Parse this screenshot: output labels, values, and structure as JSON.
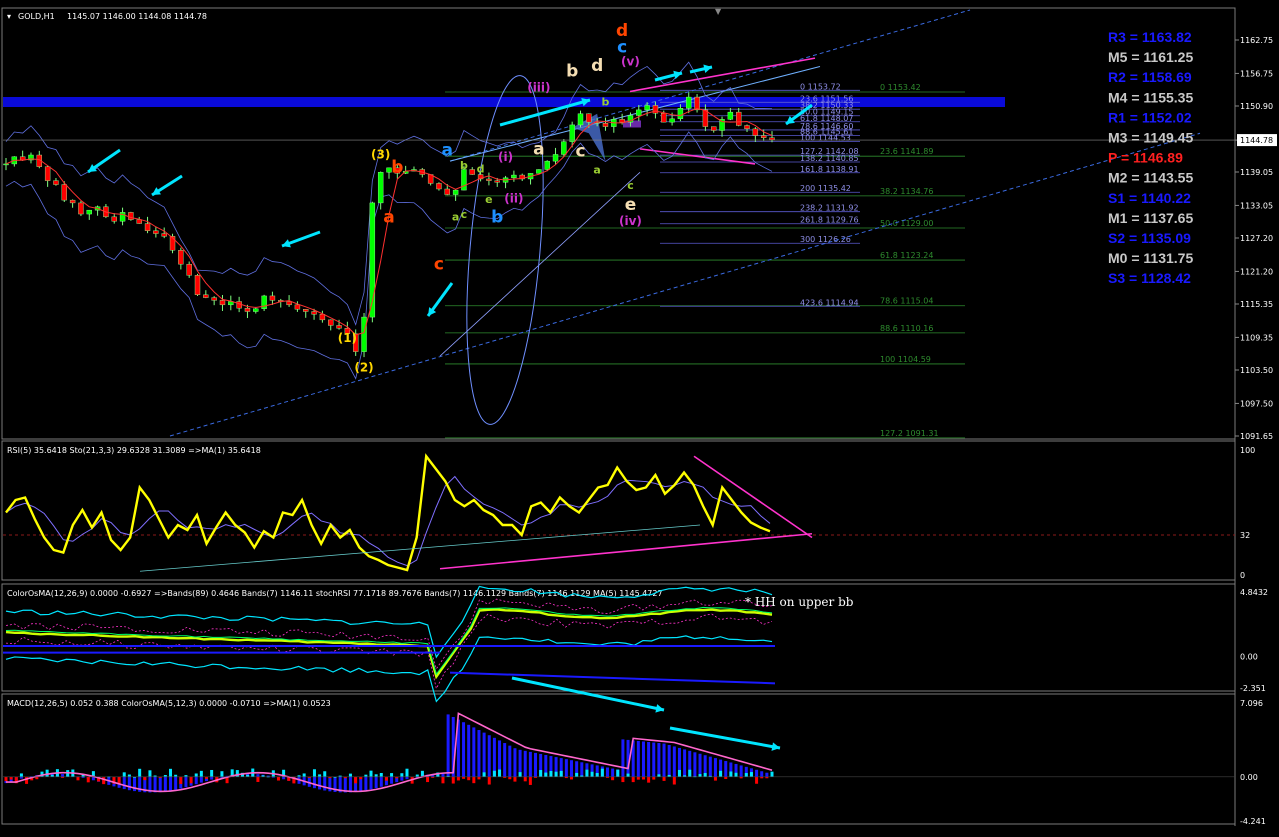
{
  "window": {
    "title": "GOLD,H1",
    "ohlc": "1145.07 1146.00 1144.08 1144.78"
  },
  "colors": {
    "up": "#00ff00",
    "down": "#ff0000",
    "rsi": "#ffff00",
    "fib": "#2e8b2e",
    "pivot_blue": "#1a1aff",
    "pivot_gray": "#c8c8c8",
    "pivot_red": "#ff2020",
    "cyan": "#00e5ff",
    "magenta": "#ff33cc"
  },
  "chart_data": [
    {
      "type": "line",
      "title": "GOLD,H1",
      "price_axis": [
        "1162.75",
        "1156.75",
        "1150.90",
        "1144.78",
        "1139.05",
        "1133.05",
        "1127.20",
        "1121.20",
        "1115.35",
        "1109.35",
        "1103.50",
        "1097.50",
        "1091.65"
      ],
      "ylim": [
        1091.65,
        1165.0
      ],
      "current_price": "1144.78",
      "price_path": [
        1140.5,
        1141.8,
        1141.2,
        1142.1,
        1140.0,
        1137.5,
        1136.8,
        1134.0,
        1133.5,
        1131.5,
        1132.2,
        1132.8,
        1131.0,
        1130.2,
        1131.8,
        1130.5,
        1129.8,
        1128.5,
        1128.0,
        1127.5,
        1125.0,
        1122.5,
        1120.5,
        1117.0,
        1116.5,
        1116.0,
        1115.2,
        1115.8,
        1114.6,
        1114.0,
        1114.5,
        1116.8,
        1116.0,
        1115.8,
        1115.2,
        1114.4,
        1114.0,
        1113.5,
        1112.5,
        1111.5,
        1111.0,
        1110.0,
        1106.8,
        1113.0,
        1133.5,
        1139.0,
        1139.8,
        1138.8,
        1139.2,
        1139.5,
        1138.6,
        1137.0,
        1136.0,
        1135.0,
        1135.8,
        1139.5,
        1138.6,
        1137.8,
        1137.5,
        1137.2,
        1138.0,
        1138.5,
        1137.8,
        1138.8,
        1139.5,
        1141.0,
        1142.2,
        1144.5,
        1147.5,
        1149.5,
        1148.0,
        1147.8,
        1147.2,
        1148.5,
        1148.0,
        1149.2,
        1150.2,
        1151.0,
        1149.6,
        1148.0,
        1148.6,
        1150.5,
        1152.5,
        1150.2,
        1147.2,
        1146.5,
        1148.5,
        1149.8,
        1147.4,
        1146.8,
        1145.6,
        1145.2,
        1144.8
      ],
      "fibonacci_levels": [
        {
          "level": "0",
          "price": "1153.42",
          "label": "0 1153.42"
        },
        {
          "level": "23.6",
          "price": "1141.89",
          "label": "23.6 1141.89"
        },
        {
          "level": "38.2",
          "price": "1134.76",
          "label": "38.2 1134.76"
        },
        {
          "level": "50.0",
          "price": "1129.00",
          "label": "50.0 1129.00"
        },
        {
          "level": "61.8",
          "price": "1123.24",
          "label": "61.8 1123.24"
        },
        {
          "level": "78.6",
          "price": "1115.04",
          "label": "78.6 1115.04"
        },
        {
          "level": "88.6",
          "price": "1110.16",
          "label": "88.6 1110.16"
        },
        {
          "level": "100",
          "price": "1104.59",
          "label": "100 1104.59"
        },
        {
          "level": "127.2",
          "price": "1091.31",
          "label": "127.2 1091.31"
        }
      ],
      "fib_extensions": [
        {
          "price": "1153.72",
          "label": "0 1153.72"
        },
        {
          "price": "1151.56",
          "label": "23.6 1151.56"
        },
        {
          "price": "1150.33",
          "label": "38.2 1150.33"
        },
        {
          "price": "1149.15",
          "label": "50.0 1149.15"
        },
        {
          "price": "1148.07",
          "label": "61.8 1148.07"
        },
        {
          "price": "1146.60",
          "label": "78.6 1146.60"
        },
        {
          "price": "1145.61",
          "label": "88.6 1145.61"
        },
        {
          "price": "1144.53",
          "label": "100 1144.53"
        },
        {
          "price": "1142.08",
          "label": "127.2 1142.08"
        },
        {
          "price": "1140.85",
          "label": "138.2 1140.85"
        },
        {
          "price": "1138.91",
          "label": "161.8 1138.91"
        },
        {
          "price": "1135.42",
          "label": "200 1135.42"
        },
        {
          "price": "1131.92",
          "label": "238.2 1131.92"
        },
        {
          "price": "1129.76",
          "label": "261.8 1129.76"
        },
        {
          "price": "1126.26",
          "label": "300 1126.26"
        },
        {
          "price": "1114.94",
          "label": "423.6 1114.94"
        }
      ],
      "pivot_levels": [
        {
          "label": "R3 = 1163.82",
          "kind": "blue"
        },
        {
          "label": "M5 = 1161.25",
          "kind": "gray"
        },
        {
          "label": "R2 = 1158.69",
          "kind": "blue"
        },
        {
          "label": "M4 = 1155.35",
          "kind": "gray"
        },
        {
          "label": "R1 = 1152.02",
          "kind": "blue"
        },
        {
          "label": "M3 = 1149.45",
          "kind": "gray"
        },
        {
          "label": "P = 1146.89",
          "kind": "red"
        },
        {
          "label": "M2 = 1143.55",
          "kind": "gray"
        },
        {
          "label": "S1 = 1140.22",
          "kind": "blue"
        },
        {
          "label": "M1 = 1137.65",
          "kind": "gray"
        },
        {
          "label": "S2 = 1135.09",
          "kind": "blue"
        },
        {
          "label": "M0 = 1131.75",
          "kind": "gray"
        },
        {
          "label": "S3 = 1128.42",
          "kind": "blue"
        }
      ],
      "wave_labels": [
        {
          "text": "(3)",
          "price": 1141.5,
          "bar": 45,
          "color": "#ffd700"
        },
        {
          "text": "(1)",
          "price": 1108.5,
          "bar": 41,
          "color": "#ffd700"
        },
        {
          "text": "(2)",
          "price": 1103.2,
          "bar": 43,
          "color": "#ffd700"
        },
        {
          "text": "b",
          "price": 1139.0,
          "bar": 47,
          "color": "#ff4500"
        },
        {
          "text": "a",
          "price": 1130.0,
          "bar": 46,
          "color": "#ff4500"
        },
        {
          "text": "c",
          "price": 1121.5,
          "bar": 52,
          "color": "#ff4500"
        },
        {
          "text": "d",
          "price": 1163.5,
          "bar": 74,
          "color": "#ff4500"
        },
        {
          "text": "a",
          "price": 1142.0,
          "bar": 53,
          "color": "#1e90ff"
        },
        {
          "text": "b",
          "price": 1130.0,
          "bar": 59,
          "color": "#1e90ff"
        },
        {
          "text": "c",
          "price": 1160.5,
          "bar": 74,
          "color": "#1e90ff"
        },
        {
          "text": "b",
          "price": 1139.6,
          "bar": 55,
          "color": "#9acd32"
        },
        {
          "text": "d",
          "price": 1139.0,
          "bar": 57,
          "color": "#9acd32"
        },
        {
          "text": "a",
          "price": 1130.3,
          "bar": 54,
          "color": "#9acd32"
        },
        {
          "text": "c",
          "price": 1130.8,
          "bar": 55,
          "color": "#9acd32"
        },
        {
          "text": "e",
          "price": 1133.5,
          "bar": 58,
          "color": "#9acd32"
        },
        {
          "text": "c",
          "price": 1136.0,
          "bar": 75,
          "color": "#9acd32"
        },
        {
          "text": "a",
          "price": 1138.8,
          "bar": 71,
          "color": "#9acd32"
        },
        {
          "text": "b",
          "price": 1151.0,
          "bar": 72,
          "color": "#9acd32"
        },
        {
          "text": "(i)",
          "price": 1141.0,
          "bar": 60,
          "color": "#cc33cc"
        },
        {
          "text": "(ii)",
          "price": 1133.6,
          "bar": 61,
          "color": "#cc33cc"
        },
        {
          "text": "(iii)",
          "price": 1153.5,
          "bar": 64,
          "color": "#cc33cc"
        },
        {
          "text": "(iv)",
          "price": 1129.5,
          "bar": 75,
          "color": "#cc33cc"
        },
        {
          "text": "(v)",
          "price": 1158.2,
          "bar": 75,
          "color": "#cc33cc"
        },
        {
          "text": "b",
          "price": 1156.2,
          "bar": 68,
          "color": "#f5deb3"
        },
        {
          "text": "d",
          "price": 1157.2,
          "bar": 71,
          "color": "#f5deb3"
        },
        {
          "text": "a",
          "price": 1142.2,
          "bar": 64,
          "color": "#f5deb3"
        },
        {
          "text": "c",
          "price": 1141.8,
          "bar": 69,
          "color": "#f5deb3"
        },
        {
          "text": "e",
          "price": 1132.2,
          "bar": 75,
          "color": "#f5deb3"
        }
      ]
    },
    {
      "type": "line",
      "title": "RSI(5) 35.6418  Sto(21,3,3) 29.6328 31.3089  =>MA(1) 35.6418",
      "axis": [
        "100",
        "32",
        "0"
      ],
      "ylim": [
        0,
        100
      ],
      "level": 32,
      "rsi_path": [
        50,
        60,
        62,
        45,
        30,
        20,
        18,
        40,
        52,
        38,
        50,
        28,
        20,
        30,
        70,
        60,
        45,
        30,
        40,
        36,
        48,
        25,
        38,
        50,
        40,
        34,
        22,
        35,
        30,
        50,
        48,
        60,
        40,
        25,
        40,
        30,
        36,
        22,
        15,
        12,
        8,
        6,
        4,
        30,
        95,
        85,
        75,
        60,
        55,
        60,
        52,
        48,
        40,
        40,
        32,
        55,
        58,
        50,
        62,
        55,
        50,
        60,
        70,
        72,
        86,
        75,
        68,
        70,
        80,
        65,
        72,
        82,
        72,
        55,
        40,
        70,
        60,
        50,
        42,
        38,
        35
      ]
    },
    {
      "type": "line",
      "title": "ColorOsMA(12,26,9) 0.0000 -0.6927  =>Bands(89) 0.4646  Bands(7) 1146.11  stochRSI 77.1718 89.7676  Bands(7) 1146.1129  Bands(7) 1146.1129  MA(5) 1145.4727",
      "axis": [
        "4.8432",
        "0.00",
        "-2.351"
      ],
      "ylim": [
        -2.351,
        4.8432
      ],
      "annotation": "* HH on upper bb"
    },
    {
      "type": "bar",
      "title": "MACD(12,26,5) 0.052 0.388  ColorOsMA(5,12,3) 0.0000 -0.0710  =>MA(1) 0.0523",
      "axis": [
        "7.096",
        "0.00",
        "-4.241"
      ],
      "ylim": [
        -4.241,
        7.096
      ]
    }
  ]
}
